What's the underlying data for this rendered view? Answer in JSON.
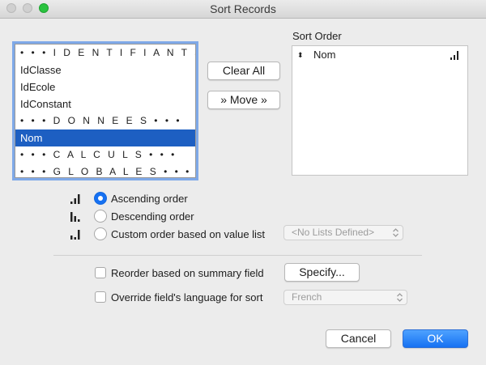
{
  "window": {
    "title": "Sort Records"
  },
  "field_list": {
    "items": [
      {
        "label": "• • • I D E N T I F I A N T S • • •",
        "type": "separator",
        "selected": false
      },
      {
        "label": "IdClasse",
        "type": "field",
        "selected": false
      },
      {
        "label": "IdEcole",
        "type": "field",
        "selected": false
      },
      {
        "label": "IdConstant",
        "type": "field",
        "selected": false
      },
      {
        "label": "• • • D O N N E E S • • •",
        "type": "separator",
        "selected": false
      },
      {
        "label": "Nom",
        "type": "field",
        "selected": true
      },
      {
        "label": "• • • C A L C U L S • • •",
        "type": "separator",
        "selected": false
      },
      {
        "label": "• • • G L O B A L E S • • •",
        "type": "separator",
        "selected": false
      }
    ]
  },
  "buttons": {
    "clear_all": "Clear All",
    "move": "» Move »",
    "specify": "Specify...",
    "cancel": "Cancel",
    "ok": "OK"
  },
  "sort_order": {
    "label": "Sort Order",
    "items": [
      {
        "handle": "⬍",
        "label": "Nom",
        "direction": "ascending"
      }
    ]
  },
  "order_options": [
    {
      "label": "Ascending order",
      "checked": true,
      "icon": "ascending-order-icon"
    },
    {
      "label": "Descending order",
      "checked": false,
      "icon": "descending-order-icon"
    },
    {
      "label": "Custom order based on value list",
      "checked": false,
      "icon": "custom-order-icon"
    }
  ],
  "value_list_select": {
    "value": "<No Lists Defined>",
    "enabled": false
  },
  "options": {
    "reorder_summary": {
      "label": "Reorder based on summary field",
      "checked": false
    },
    "override_language": {
      "label": "Override field's language for sort",
      "checked": false
    }
  },
  "language_select": {
    "value": "French",
    "enabled": false
  },
  "colors": {
    "accent": "#1671f2",
    "selection": "#1d5fc2",
    "focus_ring": "#7fa9e8",
    "window_bg": "#ececec"
  }
}
